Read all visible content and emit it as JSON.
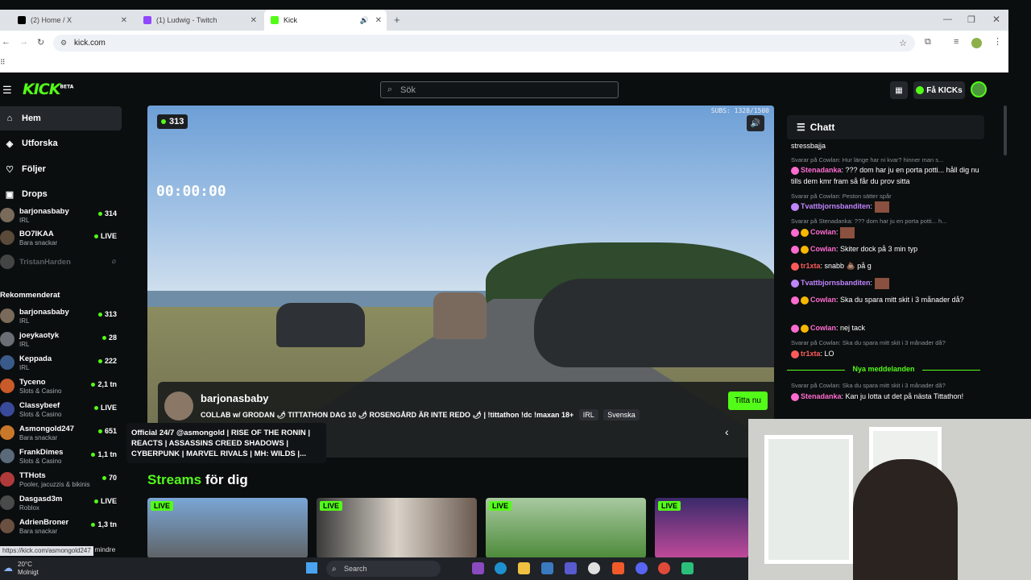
{
  "browser": {
    "tabs": [
      {
        "label": "(2) Home / X",
        "favicon_color": "#000000"
      },
      {
        "label": "(1) Ludwig - Twitch",
        "favicon_color": "#9146ff"
      },
      {
        "label": "Kick",
        "favicon_color": "#53fc18"
      }
    ],
    "new_tab_symbol": "+",
    "url": "kick.com",
    "status_url": "https://kick.com/asmongold247"
  },
  "header": {
    "logo": "KICK",
    "logo_badge": "BETA",
    "search_placeholder": "Sök",
    "get_kicks_label": "Få KICKs"
  },
  "sidebar": {
    "nav": [
      {
        "label": "Hem",
        "icon": "home-icon"
      },
      {
        "label": "Utforska",
        "icon": "compass-icon"
      },
      {
        "label": "Följer",
        "icon": "heart-icon"
      },
      {
        "label": "Drops",
        "icon": "gift-icon"
      }
    ],
    "following": [
      {
        "name": "barjonasbaby",
        "category": "IRL",
        "viewers": "314",
        "avatar": "#7a6a5a"
      },
      {
        "name": "BO7IKAA",
        "category": "Bara snackar",
        "viewers": "LIVE",
        "avatar": "#5a4a3a"
      },
      {
        "name": "TristanHarden",
        "category": "",
        "viewers": "",
        "avatar": "#444444",
        "offline": true
      }
    ],
    "recommended_title": "Rekommenderat",
    "recommended": [
      {
        "name": "barjonasbaby",
        "category": "IRL",
        "viewers": "313",
        "avatar": "#7a6a5a"
      },
      {
        "name": "joeykaotyk",
        "category": "IRL",
        "viewers": "28",
        "avatar": "#6b6f75"
      },
      {
        "name": "Keppada",
        "category": "IRL",
        "viewers": "222",
        "avatar": "#3a5a8a"
      },
      {
        "name": "Tyceno",
        "category": "Slots & Casino",
        "viewers": "2,1 tn",
        "avatar": "#c95a2a"
      },
      {
        "name": "Classybeef",
        "category": "Slots & Casino",
        "viewers": "LIVE",
        "avatar": "#3a4a9a"
      },
      {
        "name": "Asmongold247",
        "category": "Bara snackar",
        "viewers": "651",
        "avatar": "#c9782a"
      },
      {
        "name": "FrankDimes",
        "category": "Slots & Casino",
        "viewers": "1,1 tn",
        "avatar": "#5a6a7a"
      },
      {
        "name": "TTHots",
        "category": "Pooler, jacuzzis & bikinis",
        "viewers": "70",
        "avatar": "#b03a3a"
      },
      {
        "name": "Dasgasd3m",
        "category": "Roblox",
        "viewers": "LIVE",
        "avatar": "#4a4a4a"
      },
      {
        "name": "AdrienBroner",
        "category": "Bara snackar",
        "viewers": "1,3 tn",
        "avatar": "#6a5040"
      }
    ],
    "show_less": "sa mindre"
  },
  "player": {
    "viewers": "313",
    "subs": "SUBS: 1328/1500",
    "timer": "00:00:00",
    "featured": {
      "name": "barjonasbaby",
      "title": "COLLAB w/ GRODAN 🌶 TITTATHON DAG 10 🌶 ROSENGÅRD ÄR INTE REDO 🌶 | !tittathon !dc !maxan 18+",
      "tags": [
        "IRL",
        "Svenska"
      ],
      "watch_label": "Titta nu"
    }
  },
  "tooltip": "Official 24/7 @asmongold | RISE OF THE RONIN | REACTS | ASSASSINS CREED SHADOWS | CYBERPUNK | MARVEL RIVALS | MH: WILDS |...",
  "streams": {
    "title_highlight": "Streams",
    "title_rest": "för dig",
    "live_label": "LIVE"
  },
  "chat": {
    "title": "Chatt",
    "first_line": "stressbajja",
    "messages": [
      {
        "reply": "Svarar på Cowlan: Hur länge har ni kvar? hinner man s...",
        "user": "Stenadanka",
        "color": "#ff6bd0",
        "text": "??? dom har ju en porta potti... håll dig nu tills dem kmr fram så får du prov sitta"
      },
      {
        "reply": "Svarar på Cowlan: Peston sätter spår",
        "user": "Tvattbjornsbanditen",
        "color": "#c084ff",
        "text": ""
      },
      {
        "reply": "Svarar på Stenadanka: ??? dom har ju en porta potti... h...",
        "user": "Cowlan",
        "color": "#ff6bd0",
        "text": ""
      },
      {
        "reply": "",
        "user": "Cowlan",
        "color": "#ff6bd0",
        "text": "Skiter dock på 3 min typ"
      },
      {
        "reply": "",
        "user": "tr1xta",
        "color": "#ff5a5a",
        "text": "snabb 💩 på g"
      },
      {
        "reply": "",
        "user": "Tvattbjornsbanditen",
        "color": "#c084ff",
        "text": ""
      },
      {
        "reply": "",
        "user": "Cowlan",
        "color": "#ff6bd0",
        "text": "Ska du spara mitt skit i 3 månader då?"
      },
      {
        "reply": "",
        "user": "Cowlan",
        "color": "#ff6bd0",
        "text": "nej tack"
      },
      {
        "reply": "Svarar på Cowlan: Ska du spara mitt skit i 3 månader då?",
        "user": "tr1xta",
        "color": "#ff5a5a",
        "text": "LO"
      }
    ],
    "new_messages_label": "Nya meddelanden",
    "after": {
      "reply": "Svarar på Cowlan: Ska du spara mitt skit i 3 månader då?",
      "user": "Stenadanka",
      "color": "#ff6bd0",
      "text": "Kan ju lotta ut det på nästa Tittathon!"
    }
  },
  "taskbar": {
    "temp": "20°C",
    "weather": "Molnigt",
    "search_label": "Search"
  }
}
